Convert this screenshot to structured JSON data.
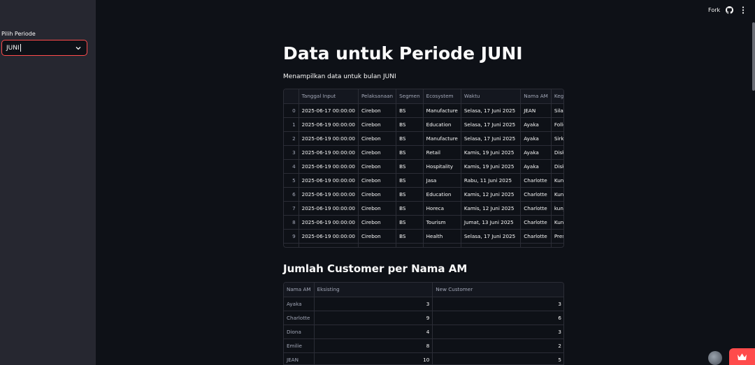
{
  "sidebar": {
    "label": "Pilih Periode",
    "select_value": "JUNI"
  },
  "header": {
    "fork_label": "Fork",
    "github_icon": "github-icon",
    "menu_icon": "kebab-menu-icon"
  },
  "main": {
    "title": "Data untuk Periode JUNI",
    "subtitle": "Menampilkan data untuk bulan JUNI"
  },
  "data_table": {
    "columns": [
      "",
      "Tanggal Input",
      "Pelaksanaan",
      "Segmen",
      "Ecosystem",
      "Waktu",
      "Nama AM",
      "Kegiata"
    ],
    "rows": [
      [
        "0",
        "2025-06-17 00:00:00",
        "Cirebon",
        "BS",
        "Manufacture",
        "Selasa, 17 Juni 2025",
        "JEAN",
        "Silatura"
      ],
      [
        "1",
        "2025-06-19 00:00:00",
        "Cirebon",
        "BS",
        "Education",
        "Selasa, 17 Juni 2025",
        "Ayaka",
        "Follow"
      ],
      [
        "2",
        "2025-06-19 00:00:00",
        "Cirebon",
        "BS",
        "Manufacture",
        "Selasa, 17 Juni 2025",
        "Ayaka",
        "Sirkulir"
      ],
      [
        "3",
        "2025-06-19 00:00:00",
        "Cirebon",
        "BS",
        "Retail",
        "Kamis, 19 Juni 2025",
        "Ayaka",
        "Diskusi"
      ],
      [
        "4",
        "2025-06-19 00:00:00",
        "Cirebon",
        "BS",
        "Hospitality",
        "Kamis, 19 Juni 2025",
        "Ayaka",
        "Diskusi"
      ],
      [
        "5",
        "2025-06-19 00:00:00",
        "Cirebon",
        "BS",
        "Jasa",
        "Rabu, 11 Juni 2025",
        "Charlotte",
        "Kunjun"
      ],
      [
        "6",
        "2025-06-19 00:00:00",
        "Cirebon",
        "BS",
        "Education",
        "Kamis, 12 Juni 2025",
        "Charlotte",
        "Kunjun"
      ],
      [
        "7",
        "2025-06-19 00:00:00",
        "Cirebon",
        "BS",
        "Horeca",
        "Kamis, 12 Juni 2025",
        "Charlotte",
        "kunjun"
      ],
      [
        "8",
        "2025-06-19 00:00:00",
        "Cirebon",
        "BS",
        "Tourism",
        "Jumat, 13 Juni 2025",
        "Charlotte",
        "Kunjun"
      ],
      [
        "9",
        "2025-06-19 00:00:00",
        "Cirebon",
        "BS",
        "Health",
        "Selasa, 17 Juni 2025",
        "Charlotte",
        "Presen"
      ]
    ]
  },
  "am_section": {
    "heading": "Jumlah Customer per Nama AM",
    "columns": [
      "Nama AM",
      "Eksisting",
      "New Customer"
    ],
    "rows": [
      [
        "Ayaka",
        "3",
        "3"
      ],
      [
        "Charlotte",
        "9",
        "6"
      ],
      [
        "Diona",
        "4",
        "3"
      ],
      [
        "Emilie",
        "8",
        "2"
      ],
      [
        "JEAN",
        "10",
        "5"
      ]
    ]
  },
  "colors": {
    "accent": "#ff4b4b",
    "background": "#0e1117",
    "sidebar": "#262730"
  }
}
